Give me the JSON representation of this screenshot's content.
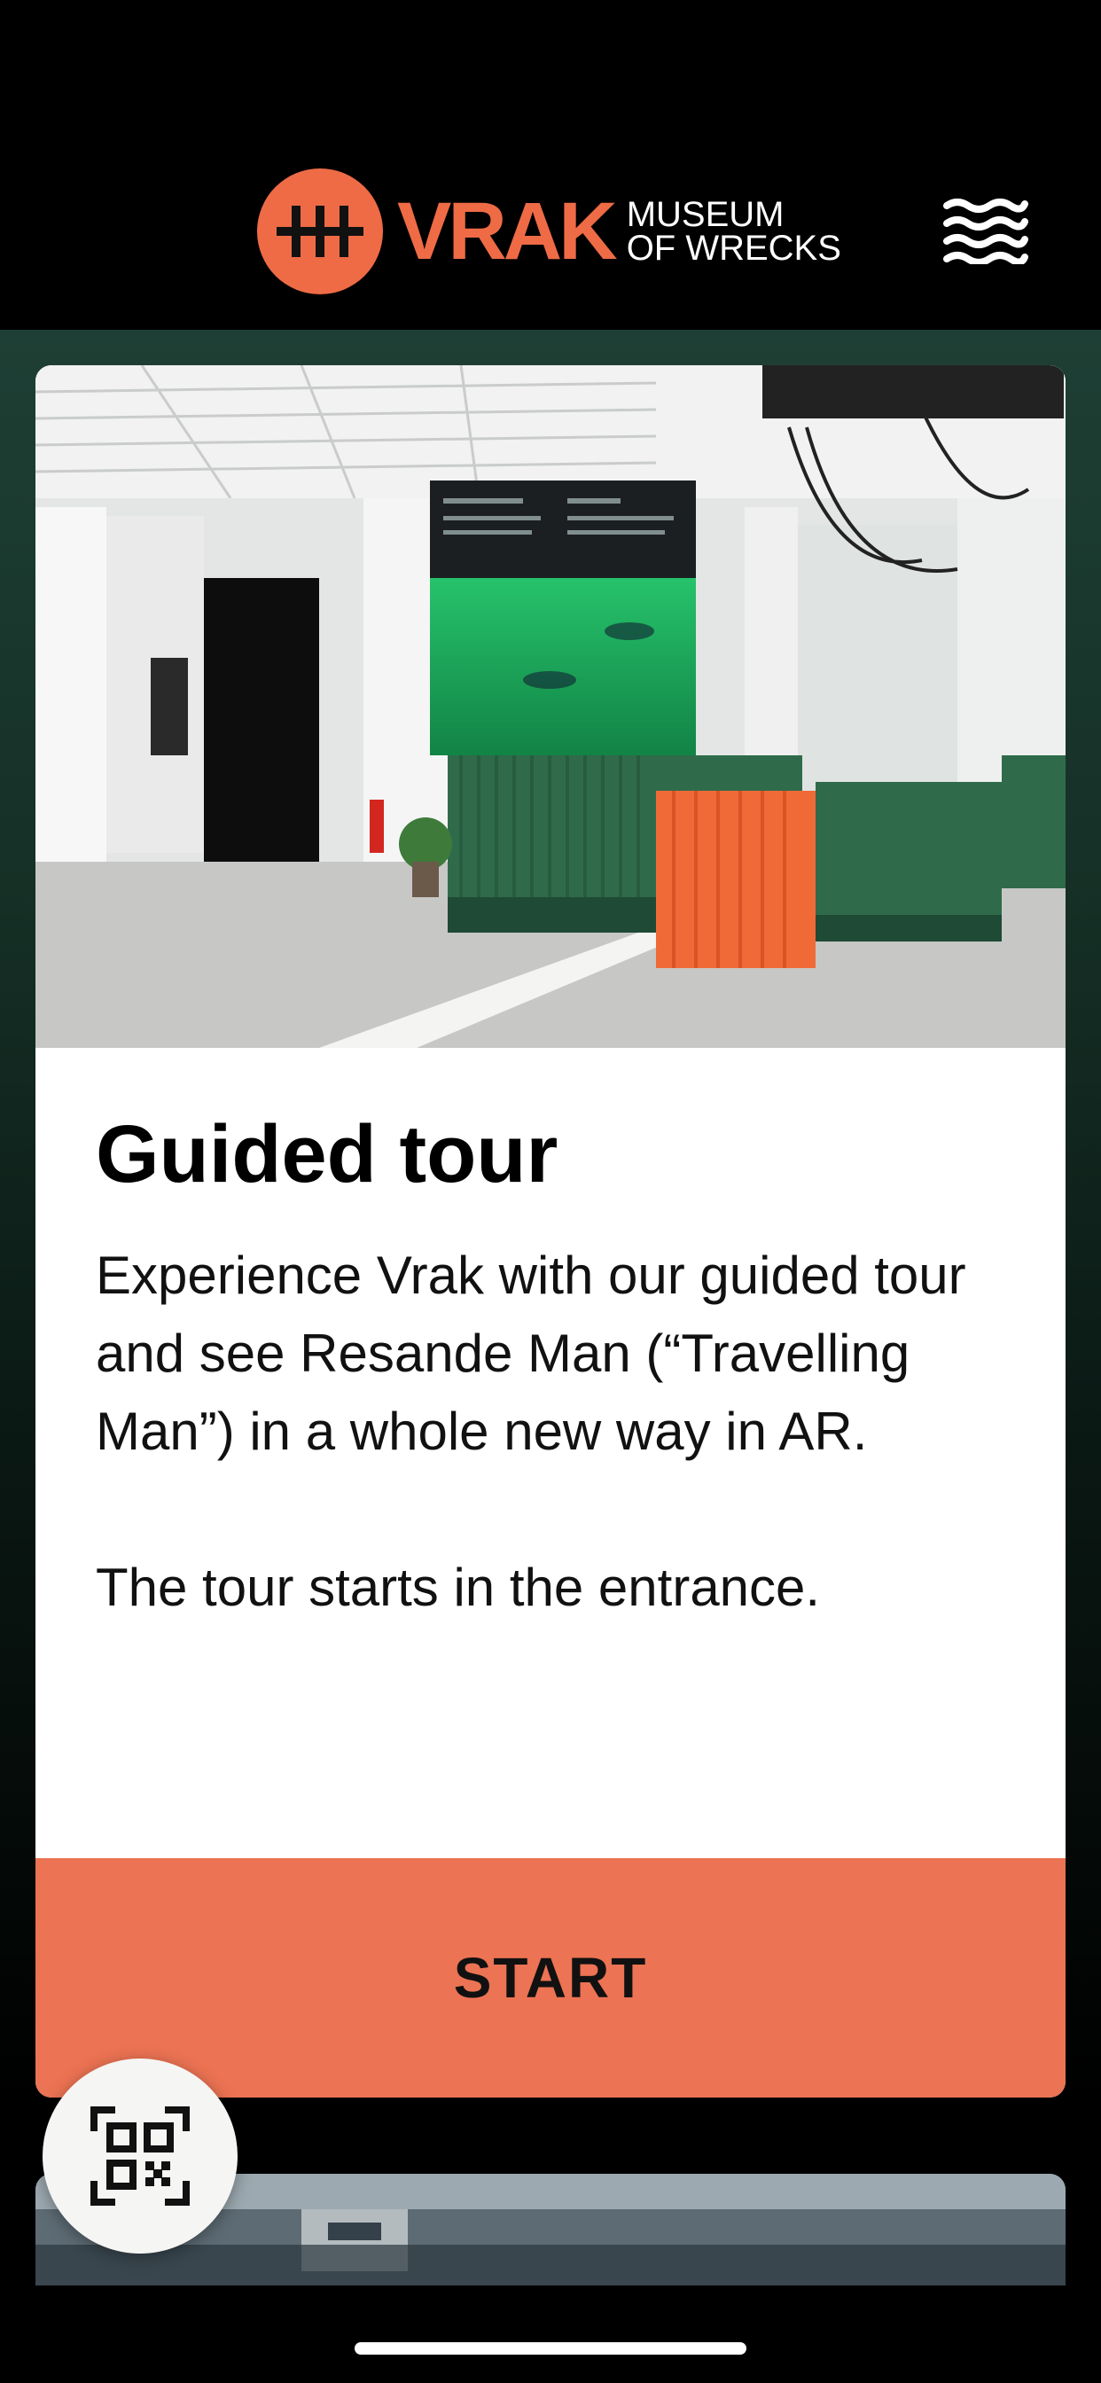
{
  "header": {
    "logo_word": "VRAK",
    "logo_sub_line1": "MUSEUM",
    "logo_sub_line2": "OF WRECKS",
    "menu_icon": "waves-menu-icon"
  },
  "card": {
    "image_icon": "museum-lobby-photo",
    "title": "Guided tour",
    "paragraph1": "Experience Vrak with our guided tour and see Resande Man (“Travelling Man”) in a whole new way in AR.",
    "paragraph2": "The tour starts in the entrance.",
    "button_label": "START"
  },
  "fab": {
    "icon": "qr-code-icon"
  },
  "colors": {
    "brand_orange": "#ee6b46",
    "button_orange": "#ec7353",
    "bg_green": "#1e3f35"
  }
}
